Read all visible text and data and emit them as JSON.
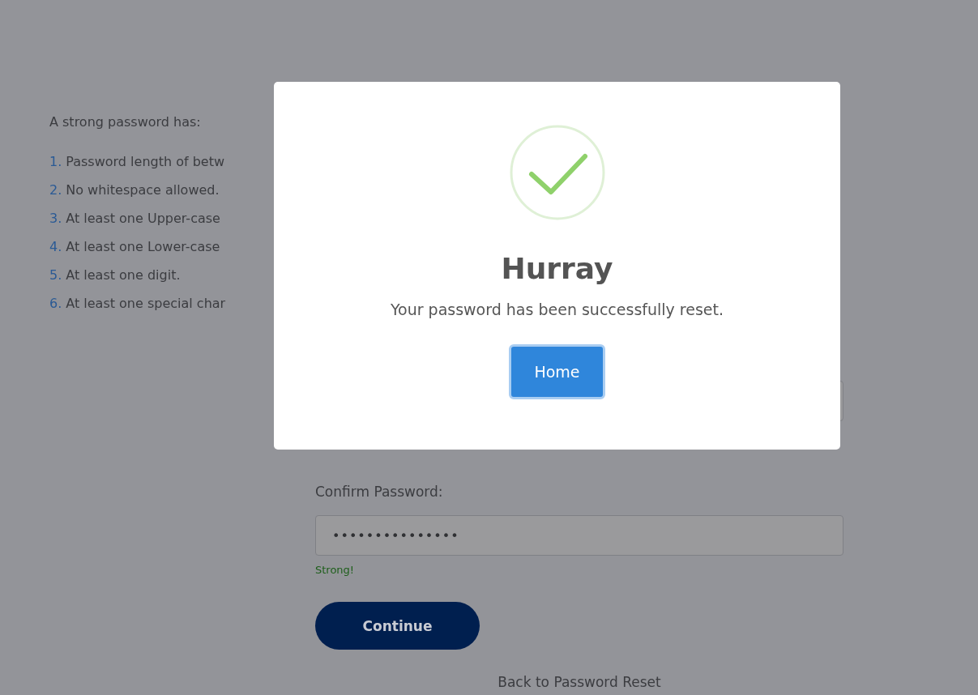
{
  "requirements": {
    "heading": "A strong password has:",
    "items": [
      {
        "number": "1.",
        "text": "Password length of betw"
      },
      {
        "number": "2.",
        "text": "No whitespace allowed."
      },
      {
        "number": "3.",
        "text": "At least one Upper-case"
      },
      {
        "number": "4.",
        "text": "At least one Lower-case"
      },
      {
        "number": "5.",
        "text": "At least one digit."
      },
      {
        "number": "6.",
        "text": "At least one special char"
      }
    ]
  },
  "form": {
    "confirm_label": "Confirm Password:",
    "confirm_value": "•••••••••••••••",
    "strength": "Strong!",
    "continue_button": "Continue",
    "back_link": "Back to Password Reset"
  },
  "dialog": {
    "title": "Hurray",
    "message": "Your password has been successfully reset.",
    "button": "Home"
  }
}
